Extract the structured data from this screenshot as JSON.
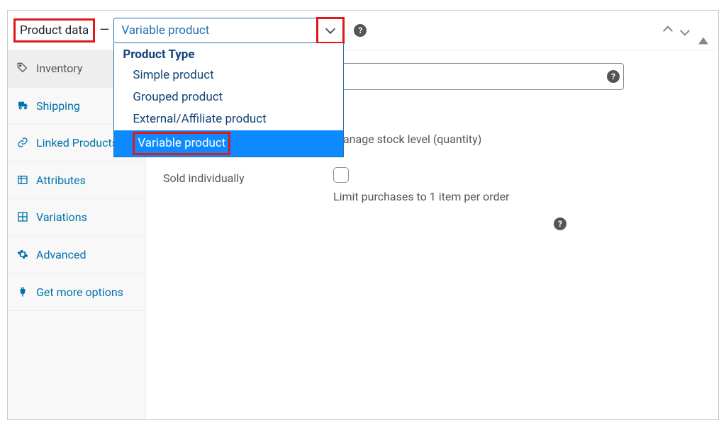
{
  "header": {
    "title": "Product data",
    "select_value": "Variable product",
    "dropdown_header": "Product Type",
    "options": [
      "Simple product",
      "Grouped product",
      "External/Affiliate product",
      "Variable product"
    ]
  },
  "sidebar": {
    "items": [
      {
        "label": "Inventory"
      },
      {
        "label": "Shipping"
      },
      {
        "label": "Linked Products"
      },
      {
        "label": "Attributes"
      },
      {
        "label": "Variations"
      },
      {
        "label": "Advanced"
      },
      {
        "label": "Get more options"
      }
    ]
  },
  "content": {
    "manage_stock_desc": "Manage stock level (quantity)",
    "sold_individually_label": "Sold individually",
    "sold_individually_desc": "Limit purchases to 1 item per order"
  }
}
